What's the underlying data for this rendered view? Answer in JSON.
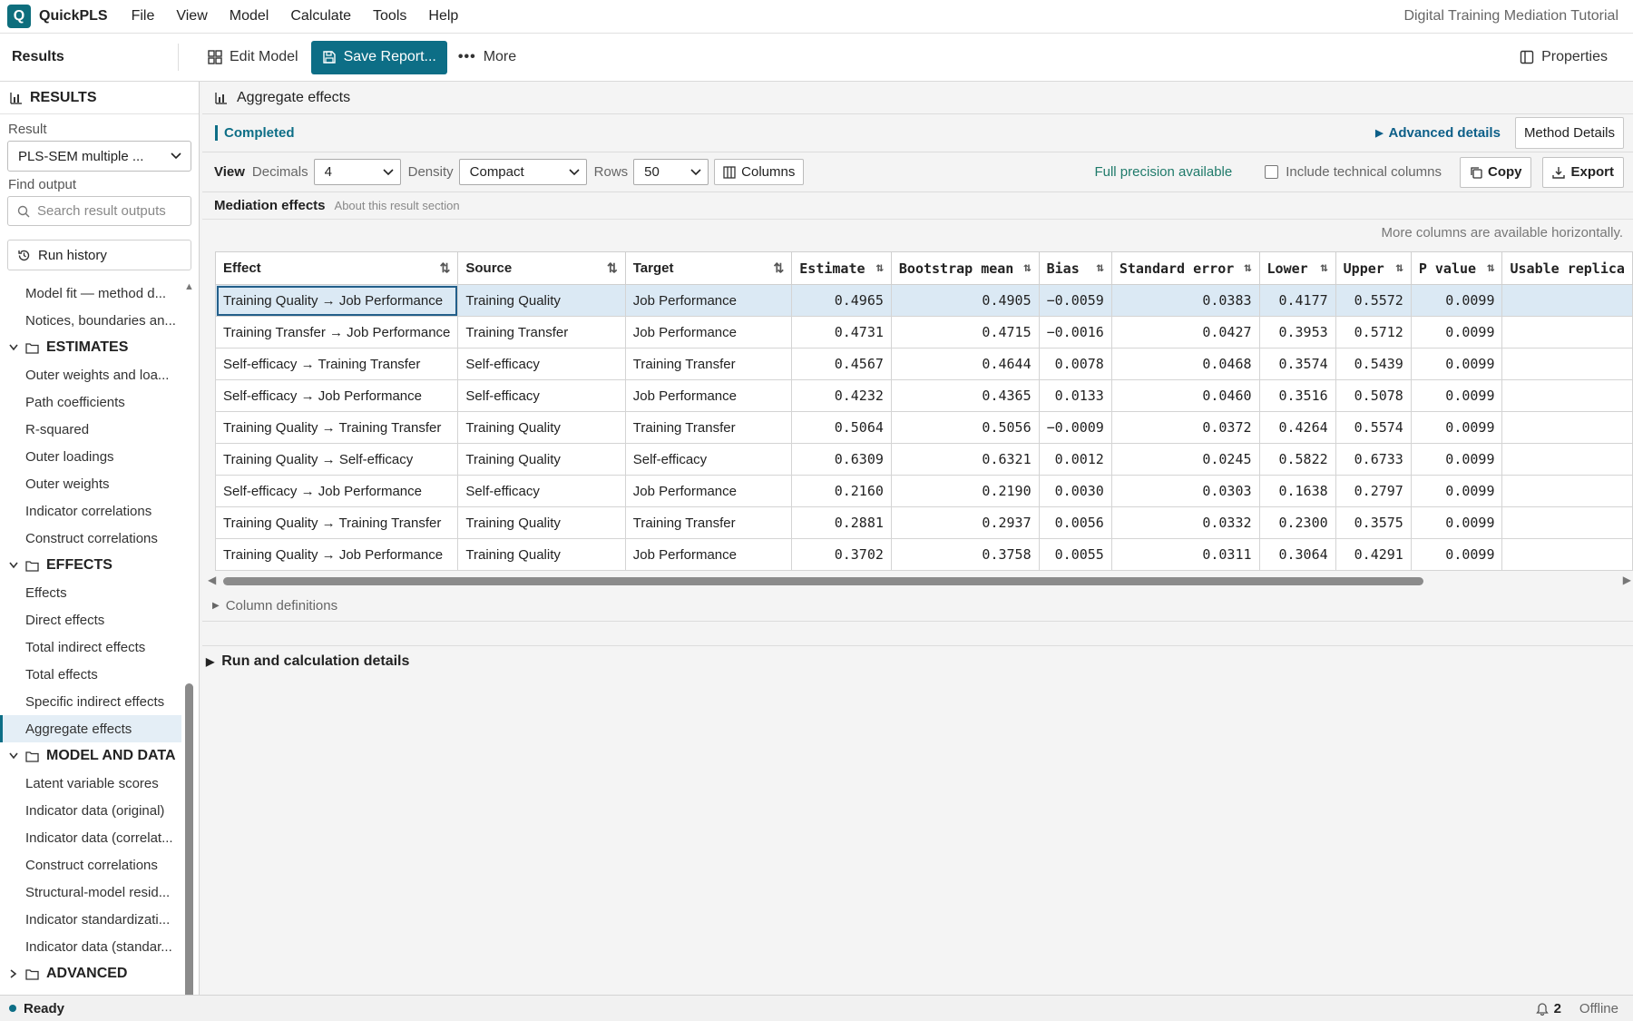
{
  "app": {
    "logo_letter": "Q",
    "name": "QuickPLS",
    "doc_title": "Digital Training Mediation Tutorial"
  },
  "menu": [
    "File",
    "View",
    "Model",
    "Calculate",
    "Tools",
    "Help"
  ],
  "toolbar": {
    "title": "Results",
    "edit_model": "Edit Model",
    "save_report": "Save Report...",
    "more": "More",
    "properties": "Properties"
  },
  "sidebar": {
    "header": "RESULTS",
    "result_label": "Result",
    "result_value": "PLS-SEM multiple ...",
    "find_label": "Find output",
    "search_placeholder": "Search result outputs",
    "run_history": "Run history",
    "items_top": [
      "Model fit — method d...",
      "Notices, boundaries an..."
    ],
    "groups": [
      {
        "label": "ESTIMATES",
        "items": [
          "Outer weights and loa...",
          "Path coefficients",
          "R-squared",
          "Outer loadings",
          "Outer weights",
          "Indicator correlations",
          "Construct correlations"
        ]
      },
      {
        "label": "EFFECTS",
        "items": [
          "Effects",
          "Direct effects",
          "Total indirect effects",
          "Total effects",
          "Specific indirect effects",
          "Aggregate effects"
        ]
      },
      {
        "label": "MODEL AND DATA",
        "items": [
          "Latent variable scores",
          "Indicator data (original)",
          "Indicator data (correlat...",
          "Construct correlations",
          "Structural-model resid...",
          "Indicator standardizati...",
          "Indicator data (standar..."
        ]
      },
      {
        "label": "ADVANCED",
        "items": []
      }
    ],
    "active_item": "Aggregate effects"
  },
  "main": {
    "section_title": "Aggregate effects",
    "status": "Completed",
    "advanced_details": "Advanced details",
    "method_details": "Method Details",
    "view": {
      "label": "View",
      "decimals_label": "Decimals",
      "decimals_value": "4",
      "density_label": "Density",
      "density_value": "Compact",
      "rows_label": "Rows",
      "rows_value": "50",
      "columns_btn": "Columns",
      "full_precision": "Full precision available",
      "include_technical": "Include technical columns",
      "copy": "Copy",
      "export": "Export"
    },
    "mediation_title": "Mediation effects",
    "mediation_about": "About this result section",
    "more_columns_note": "More columns are available horizontally.",
    "table": {
      "columns": [
        "Effect",
        "Source",
        "Target",
        "Estimate",
        "Bootstrap mean",
        "Bias",
        "Standard error",
        "Lower",
        "Upper",
        "P value",
        "Usable replica"
      ],
      "rows": [
        [
          "Training Quality → Job Performance",
          "Training Quality",
          "Job Performance",
          "0.4965",
          "0.4905",
          "−0.0059",
          "0.0383",
          "0.4177",
          "0.5572",
          "0.0099",
          ""
        ],
        [
          "Training Transfer → Job Performance",
          "Training Transfer",
          "Job Performance",
          "0.4731",
          "0.4715",
          "−0.0016",
          "0.0427",
          "0.3953",
          "0.5712",
          "0.0099",
          ""
        ],
        [
          "Self-efficacy → Training Transfer",
          "Self-efficacy",
          "Training Transfer",
          "0.4567",
          "0.4644",
          "0.0078",
          "0.0468",
          "0.3574",
          "0.5439",
          "0.0099",
          ""
        ],
        [
          "Self-efficacy → Job Performance",
          "Self-efficacy",
          "Job Performance",
          "0.4232",
          "0.4365",
          "0.0133",
          "0.0460",
          "0.3516",
          "0.5078",
          "0.0099",
          ""
        ],
        [
          "Training Quality → Training Transfer",
          "Training Quality",
          "Training Transfer",
          "0.5064",
          "0.5056",
          "−0.0009",
          "0.0372",
          "0.4264",
          "0.5574",
          "0.0099",
          ""
        ],
        [
          "Training Quality → Self-efficacy",
          "Training Quality",
          "Self-efficacy",
          "0.6309",
          "0.6321",
          "0.0012",
          "0.0245",
          "0.5822",
          "0.6733",
          "0.0099",
          ""
        ],
        [
          "Self-efficacy → Job Performance",
          "Self-efficacy",
          "Job Performance",
          "0.2160",
          "0.2190",
          "0.0030",
          "0.0303",
          "0.1638",
          "0.2797",
          "0.0099",
          ""
        ],
        [
          "Training Quality → Training Transfer",
          "Training Quality",
          "Training Transfer",
          "0.2881",
          "0.2937",
          "0.0056",
          "0.0332",
          "0.2300",
          "0.3575",
          "0.0099",
          ""
        ],
        [
          "Training Quality → Job Performance",
          "Training Quality",
          "Job Performance",
          "0.3702",
          "0.3758",
          "0.0055",
          "0.0311",
          "0.3064",
          "0.4291",
          "0.0099",
          ""
        ]
      ]
    },
    "column_definitions": "Column definitions",
    "run_calc_details": "Run and calculation details"
  },
  "statusbar": {
    "status": "Ready",
    "notifications": "2",
    "connection": "Offline"
  },
  "colors": {
    "accent": "#0d6e86",
    "selected_row": "#dbe9f4"
  },
  "icons": [
    "quickpls-logo",
    "grid-icon",
    "save-icon",
    "more-icon",
    "properties-icon",
    "chart-icon",
    "chevron-down-icon",
    "search-icon",
    "history-icon",
    "folder-icon",
    "sort-icon",
    "columns-icon",
    "copy-icon",
    "export-icon",
    "bell-icon"
  ]
}
